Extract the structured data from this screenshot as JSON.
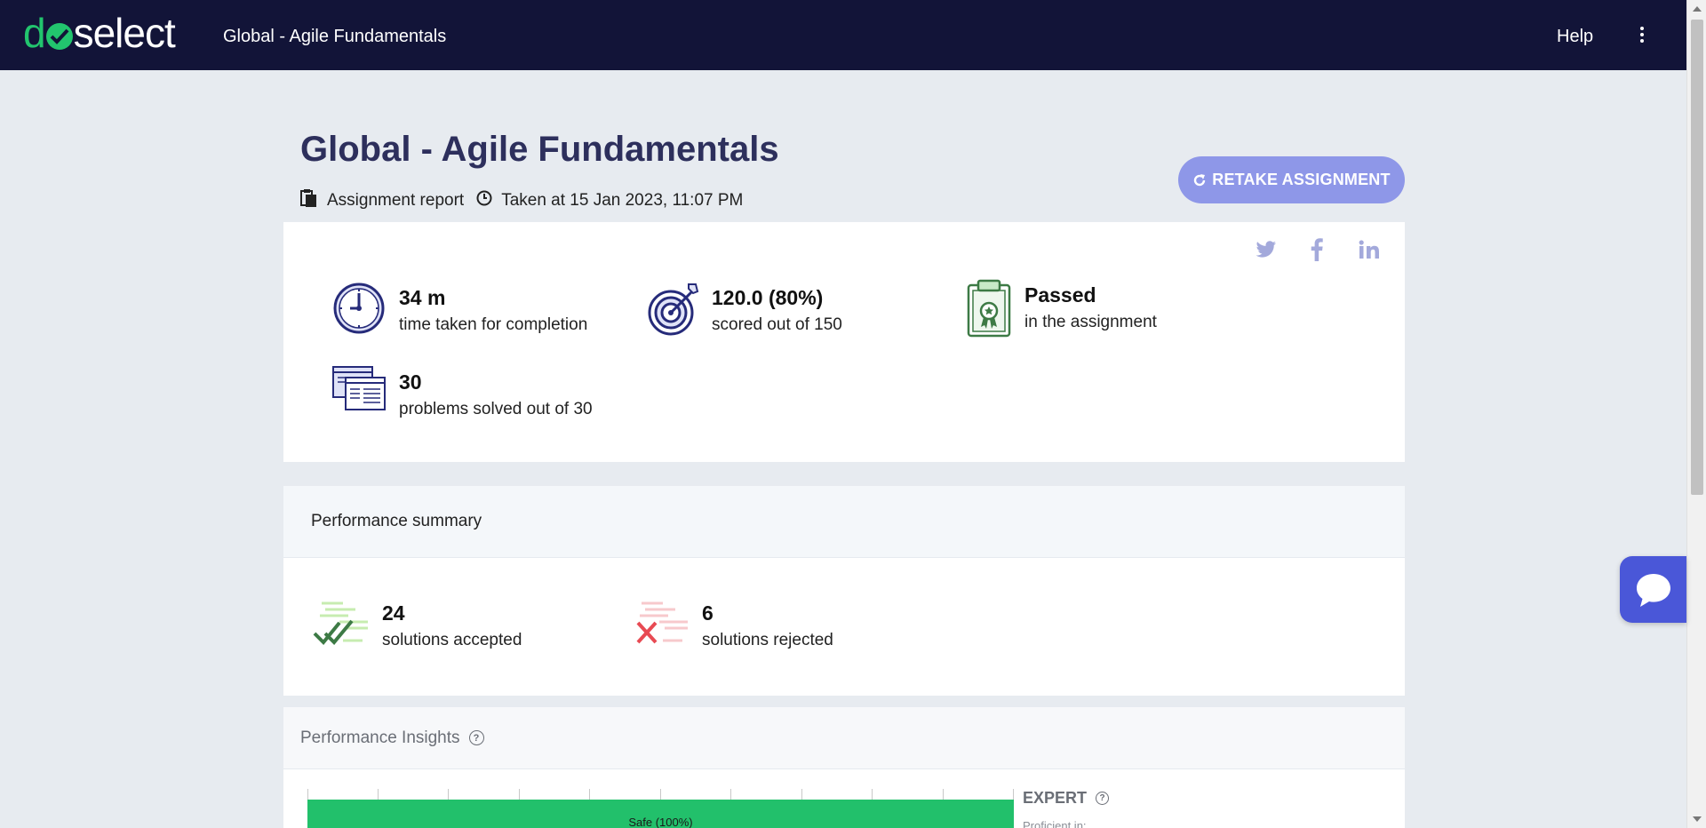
{
  "header": {
    "logo_text": "doselect",
    "title": "Global - Agile Fundamentals",
    "help_label": "Help"
  },
  "page": {
    "title": "Global - Agile Fundamentals",
    "report_label": "Assignment report",
    "taken_at": "Taken at 15 Jan 2023, 11:07 PM",
    "retake_label": "RETAKE ASSIGNMENT"
  },
  "social": [
    "twitter-icon",
    "facebook-icon",
    "linkedin-icon"
  ],
  "stats": {
    "time": {
      "value": "34 m",
      "label": "time taken for completion"
    },
    "score": {
      "value": "120.0 (80%)",
      "label": "scored out of 150"
    },
    "result": {
      "value": "Passed",
      "label": "in the assignment"
    },
    "problems": {
      "value": "30",
      "label": "problems solved out of 30"
    }
  },
  "summary": {
    "title": "Performance summary",
    "accepted": {
      "value": "24",
      "label": "solutions accepted"
    },
    "rejected": {
      "value": "6",
      "label": "solutions rejected"
    }
  },
  "insights": {
    "title": "Performance Insights",
    "bar_label": "Safe (100%)",
    "bar_percent": 100,
    "level": "EXPERT",
    "proficient_label": "Proficient in:"
  },
  "colors": {
    "nav": "#121438",
    "accent": "#22c56e",
    "retake": "#8e97e8",
    "chat": "#4a57d8"
  }
}
